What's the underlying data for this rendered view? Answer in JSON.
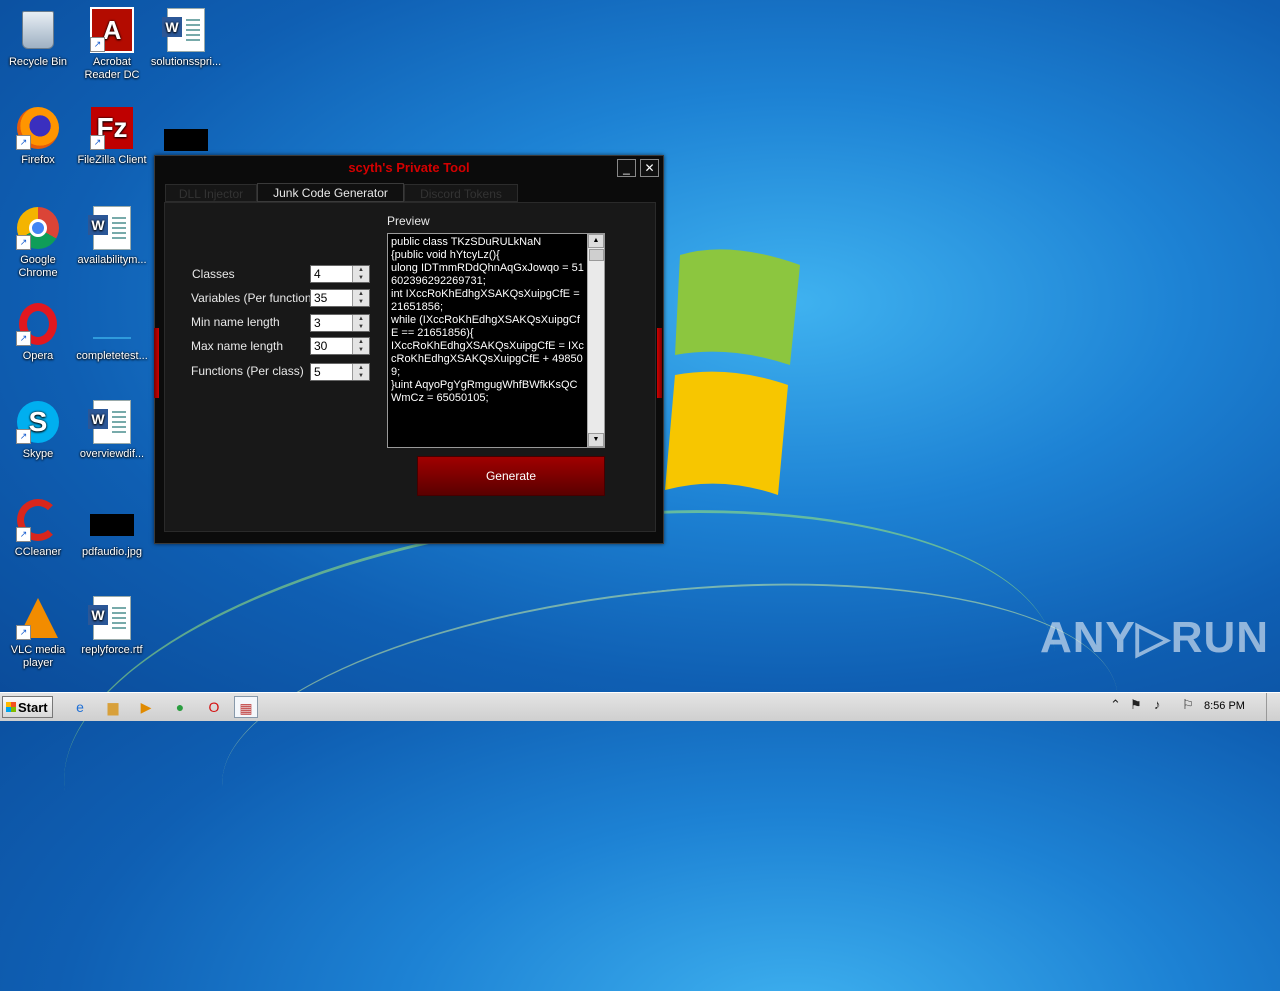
{
  "desktop": {
    "icons": [
      {
        "label": "Recycle Bin"
      },
      {
        "label": "Acrobat Reader DC"
      },
      {
        "label": "solutionsspri..."
      },
      {
        "label": "Firefox"
      },
      {
        "label": "FileZilla Client"
      },
      {
        "label": "Google Chrome"
      },
      {
        "label": "availabilitym..."
      },
      {
        "label": "Opera"
      },
      {
        "label": "completetest..."
      },
      {
        "label": "Skype"
      },
      {
        "label": "overviewdif..."
      },
      {
        "label": "CCleaner"
      },
      {
        "label": "pdfaudio.jpg"
      },
      {
        "label": "VLC media player"
      },
      {
        "label": "replyforce.rtf"
      }
    ]
  },
  "tool": {
    "title": "scyth's Private Tool",
    "minimize_glyph": "_",
    "close_glyph": "✕",
    "tabs": [
      {
        "label": "DLL Injector"
      },
      {
        "label": "Junk Code Generator"
      },
      {
        "label": "Discord Tokens"
      }
    ],
    "preview_label": "Preview",
    "fields": [
      {
        "label": "Classes",
        "value": "4"
      },
      {
        "label": "Variables (Per function)",
        "value": "35"
      },
      {
        "label": "Min name length",
        "value": "3"
      },
      {
        "label": "Max name length",
        "value": "30"
      },
      {
        "label": "Functions (Per class)",
        "value": "5"
      }
    ],
    "preview_code": "public class TKzSDuRULkNaN\n{public void hYtcyLz(){\nulong IDTmmRDdQhnAqGxJowqo = 51602396292269731;\nint IXccRoKhEdhgXSAKQsXuipgCfE = 21651856;\nwhile (IXccRoKhEdhgXSAKQsXuipgCfE == 21651856){\nIXccRoKhEdhgXSAKQsXuipgCfE = IXccRoKhEdhgXSAKQsXuipgCfE + 498509;\n}uint AqyoPgYgRmgugWhfBWfkKsQCWmCz = 65050105;",
    "generate_label": "Generate"
  },
  "watermark": "ANY▷RUN",
  "taskbar": {
    "start_label": "Start",
    "clock": "8:56 PM"
  }
}
